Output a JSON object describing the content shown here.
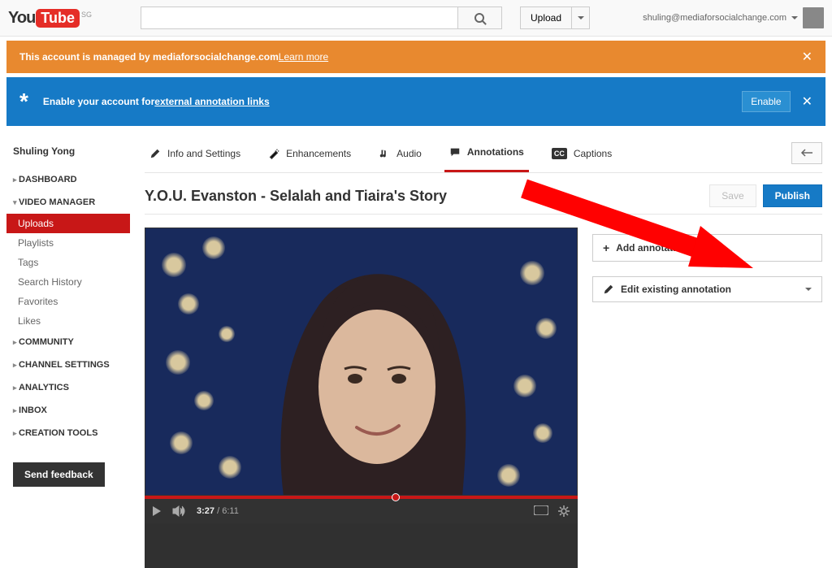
{
  "header": {
    "logo_you": "You",
    "logo_tube": "Tube",
    "region": "SG",
    "search_placeholder": "",
    "upload_label": "Upload",
    "user_email": "shuling@mediaforsocialchange.com"
  },
  "banners": {
    "orange_prefix": "This account is managed by mediaforsocialchange.com ",
    "orange_link": "Learn more",
    "blue_prefix": "Enable your account for ",
    "blue_link": "external annotation links",
    "enable_label": "Enable"
  },
  "sidebar": {
    "channel_name": "Shuling Yong",
    "sections": [
      {
        "label": "DASHBOARD",
        "expanded": false
      },
      {
        "label": "VIDEO MANAGER",
        "expanded": true
      },
      {
        "label": "COMMUNITY",
        "expanded": false
      },
      {
        "label": "CHANNEL SETTINGS",
        "expanded": false
      },
      {
        "label": "ANALYTICS",
        "expanded": false
      },
      {
        "label": "INBOX",
        "expanded": false
      },
      {
        "label": "CREATION TOOLS",
        "expanded": false
      }
    ],
    "video_manager_items": [
      {
        "label": "Uploads",
        "active": true
      },
      {
        "label": "Playlists"
      },
      {
        "label": "Tags"
      },
      {
        "label": "Search History"
      },
      {
        "label": "Favorites"
      },
      {
        "label": "Likes"
      }
    ],
    "feedback_label": "Send feedback"
  },
  "tabs": [
    {
      "label": "Info and Settings",
      "icon": "pencil-icon"
    },
    {
      "label": "Enhancements",
      "icon": "wand-icon"
    },
    {
      "label": "Audio",
      "icon": "note-icon"
    },
    {
      "label": "Annotations",
      "icon": "speech-icon",
      "active": true
    },
    {
      "label": "Captions",
      "icon": "cc-icon"
    }
  ],
  "title_row": {
    "video_title": "Y.O.U. Evanston - Selalah and Tiaira's Story",
    "save_label": "Save",
    "publish_label": "Publish"
  },
  "player": {
    "current_time": "3:27",
    "duration": "6:11"
  },
  "right_panel": {
    "add_label": "Add annotation",
    "edit_label": "Edit existing annotation"
  }
}
